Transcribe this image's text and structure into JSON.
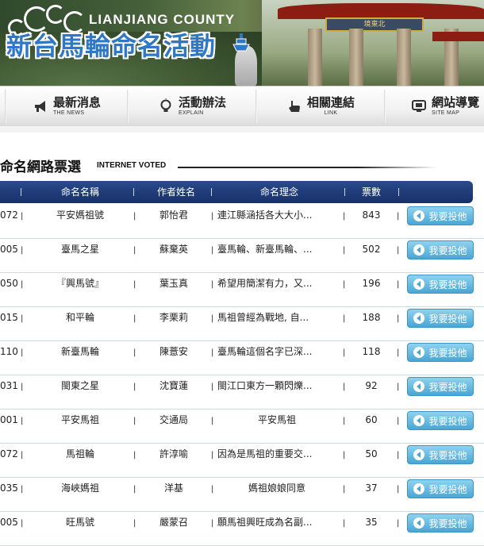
{
  "header": {
    "county": "LIANJIANG COUNTY",
    "title": "新台馬輪命名活動",
    "gate_text": "境東北",
    "icons": [
      "swirl-logo",
      "ship-icon"
    ]
  },
  "nav": [
    {
      "zh": "最新消息",
      "en": "THE NEWS",
      "icon": "megaphone-icon"
    },
    {
      "zh": "活動辦法",
      "en": "EXPLAIN",
      "icon": "lightbulb-icon"
    },
    {
      "zh": "相關連結",
      "en": "LINK",
      "icon": "link-hand-icon"
    },
    {
      "zh": "網站導覽",
      "en": "SITE MAP",
      "icon": "monitor-icon"
    }
  ],
  "section": {
    "title": "命名網路票選",
    "subtitle": "INTERNET VOTED"
  },
  "table": {
    "headers": [
      "命名名稱",
      "作者姓名",
      "命名理念",
      "票數"
    ],
    "vote_label": "我要投他",
    "rows": [
      {
        "id": "072",
        "name": "平安媽祖號",
        "author": "郭怡君",
        "idea": "連江縣涵括各大大小...",
        "votes": "843"
      },
      {
        "id": "005",
        "name": "臺馬之星",
        "author": "蘇棄英",
        "idea": "臺馬輪、新臺馬輪、...",
        "votes": "502"
      },
      {
        "id": "050",
        "name": "『興馬號』",
        "author": "葉玉真",
        "idea": "希望用簡潔有力，又...",
        "votes": "196"
      },
      {
        "id": "015",
        "name": "和平輪",
        "author": "李栗莉",
        "idea": "馬祖曾經為戰地, 自...",
        "votes": "188"
      },
      {
        "id": "110",
        "name": "新臺馬輪",
        "author": "陳薏安",
        "idea": "臺馬輪這個名字已深...",
        "votes": "118"
      },
      {
        "id": "031",
        "name": "閩東之星",
        "author": "沈寶蓮",
        "idea": "閩江口東方一顆閃爍...",
        "votes": "92"
      },
      {
        "id": "001",
        "name": "平安馬祖",
        "author": "交通局",
        "idea": "平安馬祖",
        "votes": "60"
      },
      {
        "id": "072",
        "name": "馬祖輪",
        "author": "許淳喻",
        "idea": "因為是馬祖的重要交...",
        "votes": "50"
      },
      {
        "id": "035",
        "name": "海峽媽祖",
        "author": "洋基",
        "idea": "媽祖娘娘同意",
        "votes": "37"
      },
      {
        "id": "005",
        "name": "旺馬號",
        "author": "嚴蒙召",
        "idea": "願馬祖興旺成為名副...",
        "votes": "35"
      }
    ]
  }
}
